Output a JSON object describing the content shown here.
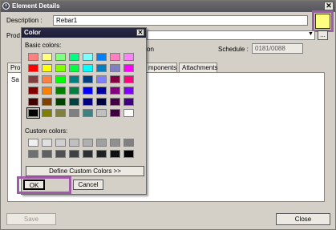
{
  "window": {
    "title": "Element Details",
    "close_glyph": "✕",
    "description_label": "Description :",
    "description_value": "Rebar1",
    "product_label": "Prod",
    "location_label": "on",
    "schedule_label": "Schedule :",
    "schedule_value": "0181/0088",
    "browse_label": "...",
    "tabs": [
      "Pro",
      "mponents",
      "Attachments"
    ],
    "panel_text": "Sa",
    "save_label": "Save",
    "close_label": "Close",
    "selected_color": "#ffff80"
  },
  "color_dialog": {
    "title": "Color",
    "close_glyph": "✕",
    "basic_label": "Basic colors:",
    "custom_label": "Custom colors:",
    "define_label": "Define Custom Colors >>",
    "ok_label": "OK",
    "cancel_label": "Cancel",
    "basic_colors": [
      [
        "#ff8080",
        "#ffff80",
        "#80ff80",
        "#00ff80",
        "#80ffff",
        "#0080ff",
        "#ff80c0",
        "#ff80ff"
      ],
      [
        "#ff0000",
        "#ffff00",
        "#80ff00",
        "#00ff40",
        "#00ffff",
        "#0080c0",
        "#8080c0",
        "#ff00ff"
      ],
      [
        "#804040",
        "#ff8040",
        "#00ff00",
        "#008080",
        "#004080",
        "#8080ff",
        "#800040",
        "#ff0080"
      ],
      [
        "#800000",
        "#ff8000",
        "#008000",
        "#008040",
        "#0000ff",
        "#0000a0",
        "#800080",
        "#8000ff"
      ],
      [
        "#400000",
        "#804000",
        "#004000",
        "#004040",
        "#000080",
        "#000040",
        "#400040",
        "#400080"
      ],
      [
        "#000000",
        "#808000",
        "#808040",
        "#808080",
        "#408080",
        "#c0c0c0",
        "#400040",
        "#ffffff"
      ]
    ],
    "custom_colors": [
      [
        "#f0f0f0",
        "#e0e0e0",
        "#d0d0d0",
        "#c0c0c0",
        "#b0b0b0",
        "#a0a0a0",
        "#909090",
        "#808080"
      ],
      [
        "#707070",
        "#606060",
        "#505050",
        "#404040",
        "#303030",
        "#202020",
        "#101010",
        "#000000"
      ]
    ]
  }
}
